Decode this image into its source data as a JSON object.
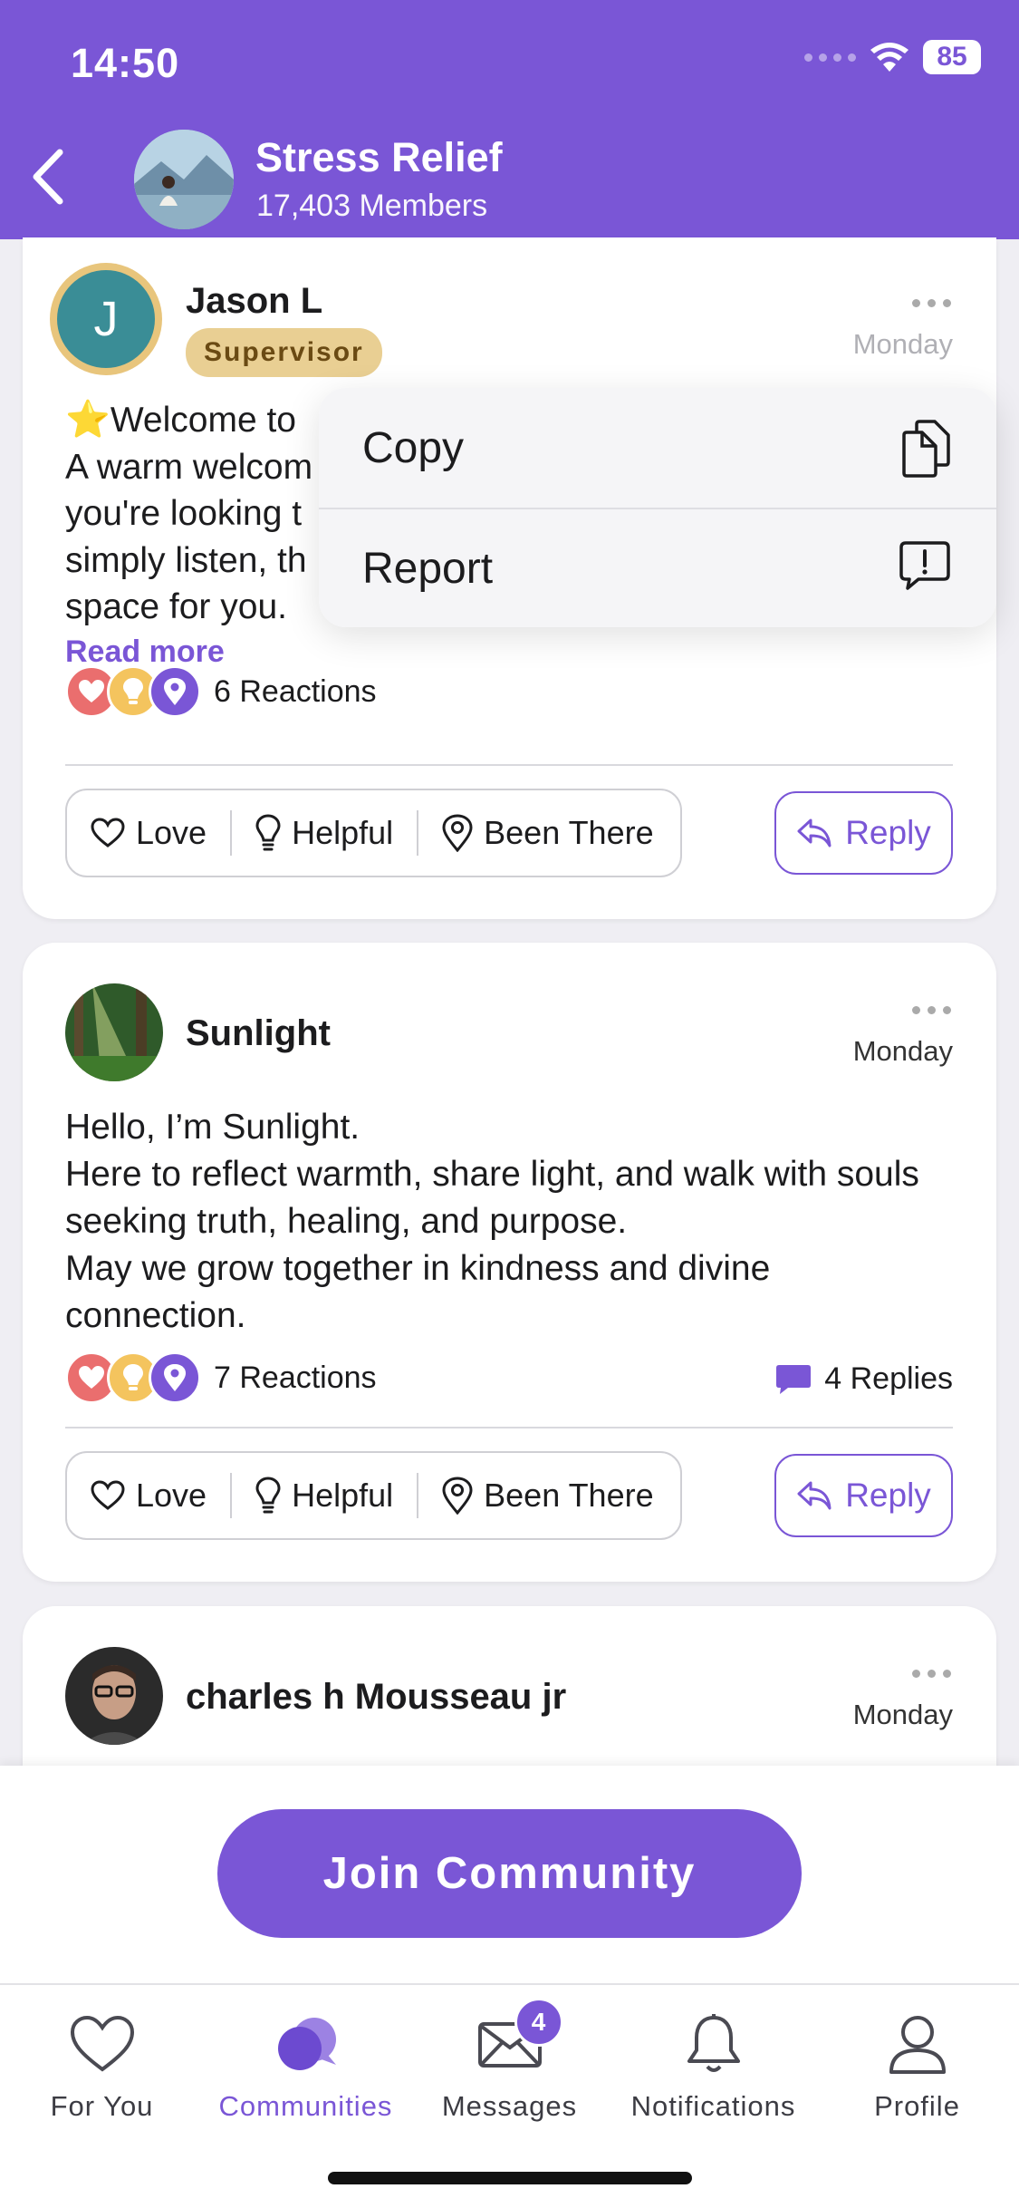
{
  "status": {
    "time": "14:50",
    "battery": "85"
  },
  "header": {
    "title": "Stress Relief",
    "members": "17,403 Members"
  },
  "posts": [
    {
      "author": "Jason L",
      "avatar_initial": "J",
      "badge": "Supervisor",
      "time": "Monday",
      "emoji": "⭐",
      "lines": [
        "Welcome to",
        "A warm welcom",
        "you're looking t",
        "simply listen, th",
        "space for you."
      ],
      "read_more": "Read more",
      "reactions": "6 Reactions"
    },
    {
      "author": "Sunlight",
      "time": "Monday",
      "text": "Hello, I’m Sunlight.\nHere to reflect warmth, share light, and walk with souls seeking truth, healing, and purpose.\nMay we grow together in kindness and divine connection.",
      "reactions": "7 Reactions",
      "replies": "4 Replies"
    },
    {
      "author": "charles h Mousseau jr",
      "time": "Monday"
    }
  ],
  "reaction_bar": {
    "love": "Love",
    "helpful": "Helpful",
    "been_there": "Been There",
    "reply": "Reply"
  },
  "context_menu": {
    "copy": "Copy",
    "report": "Report"
  },
  "join_button": "Join Community",
  "tabs": {
    "for_you": "For You",
    "communities": "Communities",
    "messages": "Messages",
    "messages_badge": "4",
    "notifications": "Notifications",
    "profile": "Profile"
  },
  "colors": {
    "accent": "#7a56d6",
    "badge": "#e9cf93",
    "love": "#ea6e6e",
    "helpful": "#f4c45e"
  }
}
